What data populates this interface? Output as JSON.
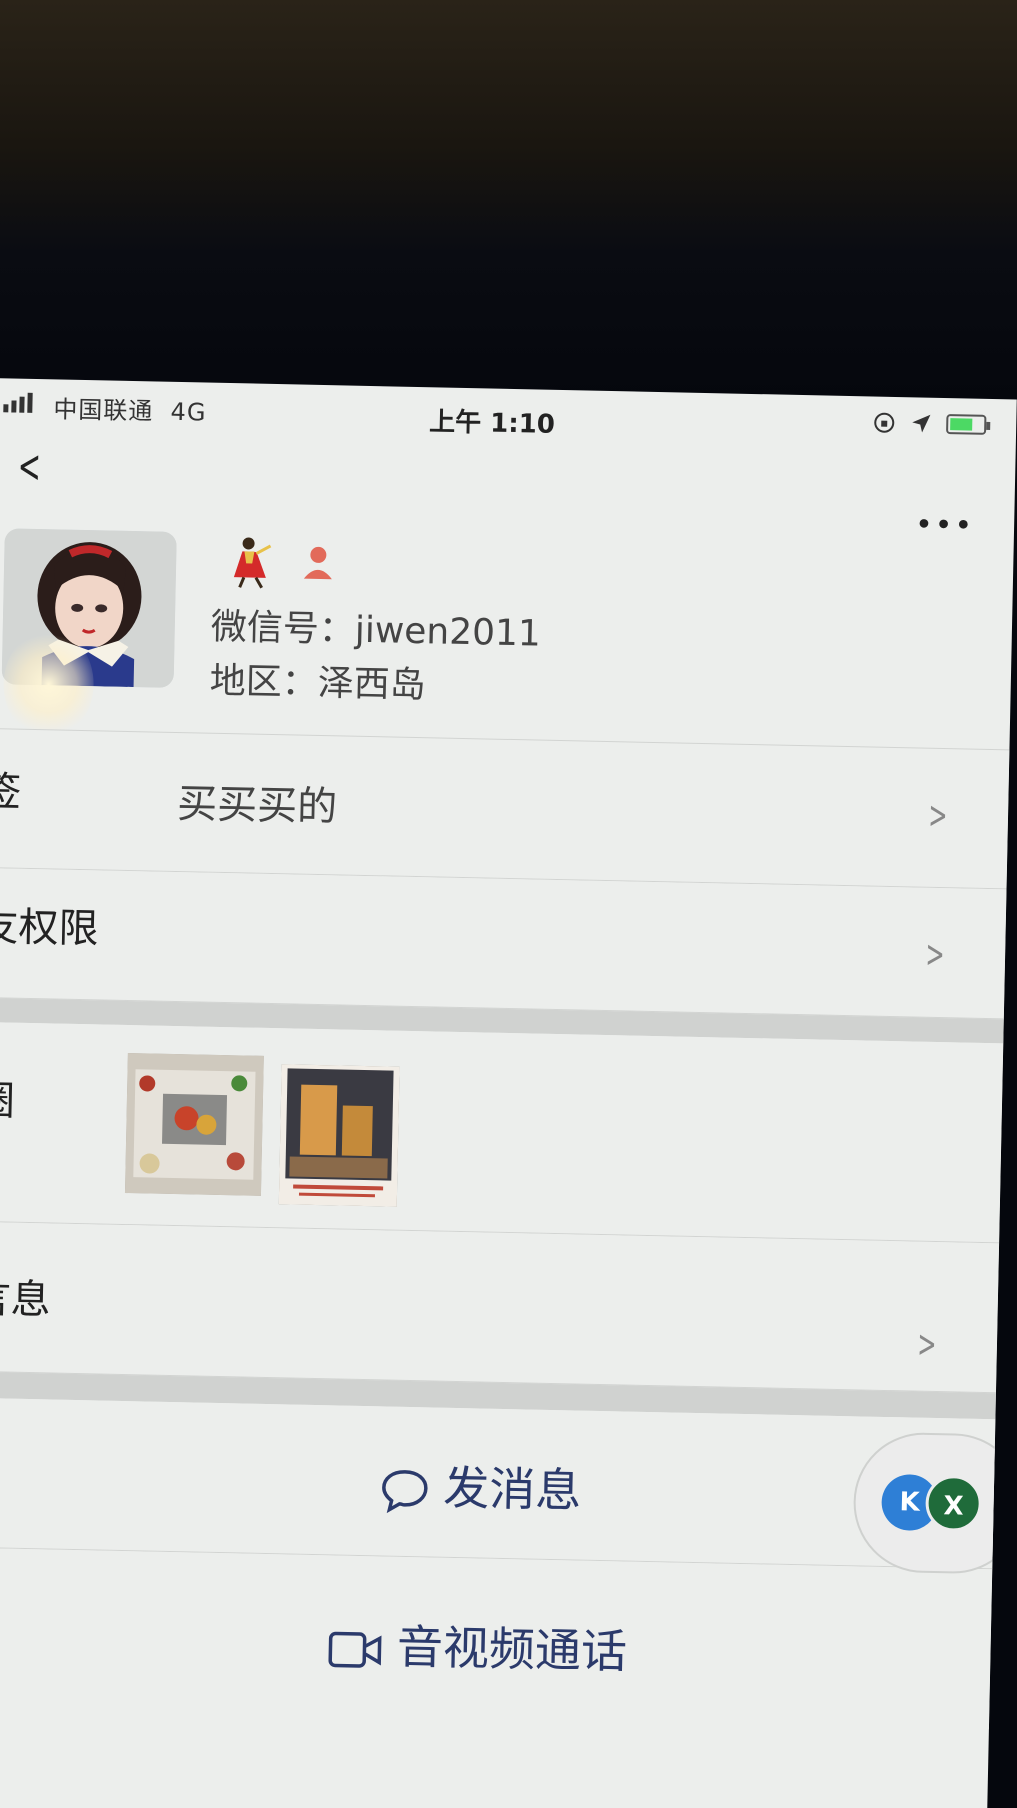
{
  "status_bar": {
    "carrier": "中国联通",
    "network": "4G",
    "time": "上午 1:10"
  },
  "nav": {
    "back_icon": "chevron-left-icon",
    "more_label": "•••"
  },
  "profile": {
    "wechat_id_label": "微信号：",
    "wechat_id": "jiwen2011",
    "region_label": "地区：",
    "region": "泽西岛"
  },
  "rows": {
    "tags_label": "签",
    "tags_value": "买买买的",
    "permissions_label": "友权限",
    "moments_label": "圈",
    "more_info_label": "言息"
  },
  "actions": {
    "send_message": "发消息",
    "video_call": "音视频通话"
  },
  "floating": {
    "bubble1": "K",
    "bubble2": "X"
  },
  "colors": {
    "accent_text": "#2b3a6b",
    "background": "#eceeec"
  }
}
